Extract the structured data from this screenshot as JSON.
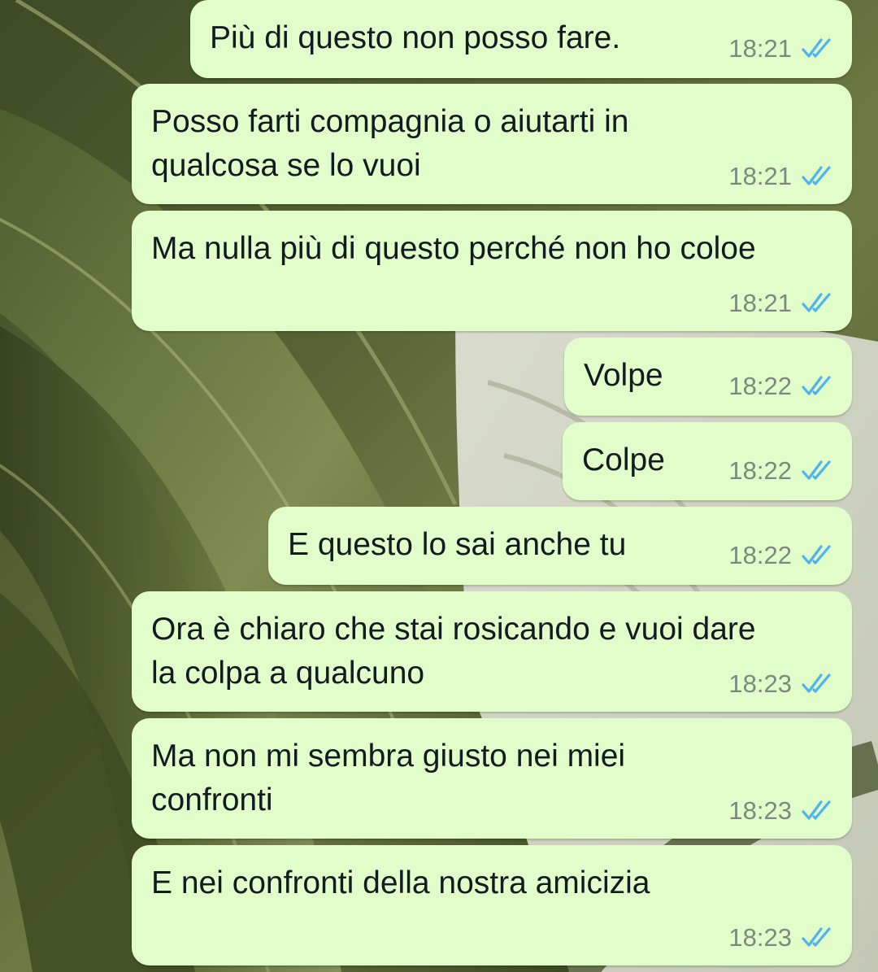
{
  "chat": {
    "theme": {
      "bubble_color": "#e1fdc9",
      "read_tick_color": "#4fb3f0",
      "time_color": "#7c8a7e"
    },
    "messages": [
      {
        "text": "Più di questo non posso fare.",
        "time": "18:21",
        "status": "read-double-tick-icon"
      },
      {
        "text": "Posso farti compagnia o aiutarti in\nqualcosa se lo vuoi",
        "time": "18:21",
        "status": "read-double-tick-icon"
      },
      {
        "text": "Ma nulla più di questo perché non ho coloe",
        "time": "18:21",
        "status": "read-double-tick-icon"
      },
      {
        "text": "Volpe",
        "time": "18:22",
        "status": "read-double-tick-icon"
      },
      {
        "text": "Colpe",
        "time": "18:22",
        "status": "read-double-tick-icon"
      },
      {
        "text": "E questo lo sai anche tu",
        "time": "18:22",
        "status": "read-double-tick-icon"
      },
      {
        "text": "Ora è chiaro che stai rosicando e vuoi dare\nla colpa a qualcuno",
        "time": "18:23",
        "status": "read-double-tick-icon"
      },
      {
        "text": "Ma non mi sembra giusto nei miei\nconfronti",
        "time": "18:23",
        "status": "read-double-tick-icon"
      },
      {
        "text": "E nei confronti della nostra amicizia",
        "time": "18:23",
        "status": "read-double-tick-icon"
      }
    ]
  }
}
